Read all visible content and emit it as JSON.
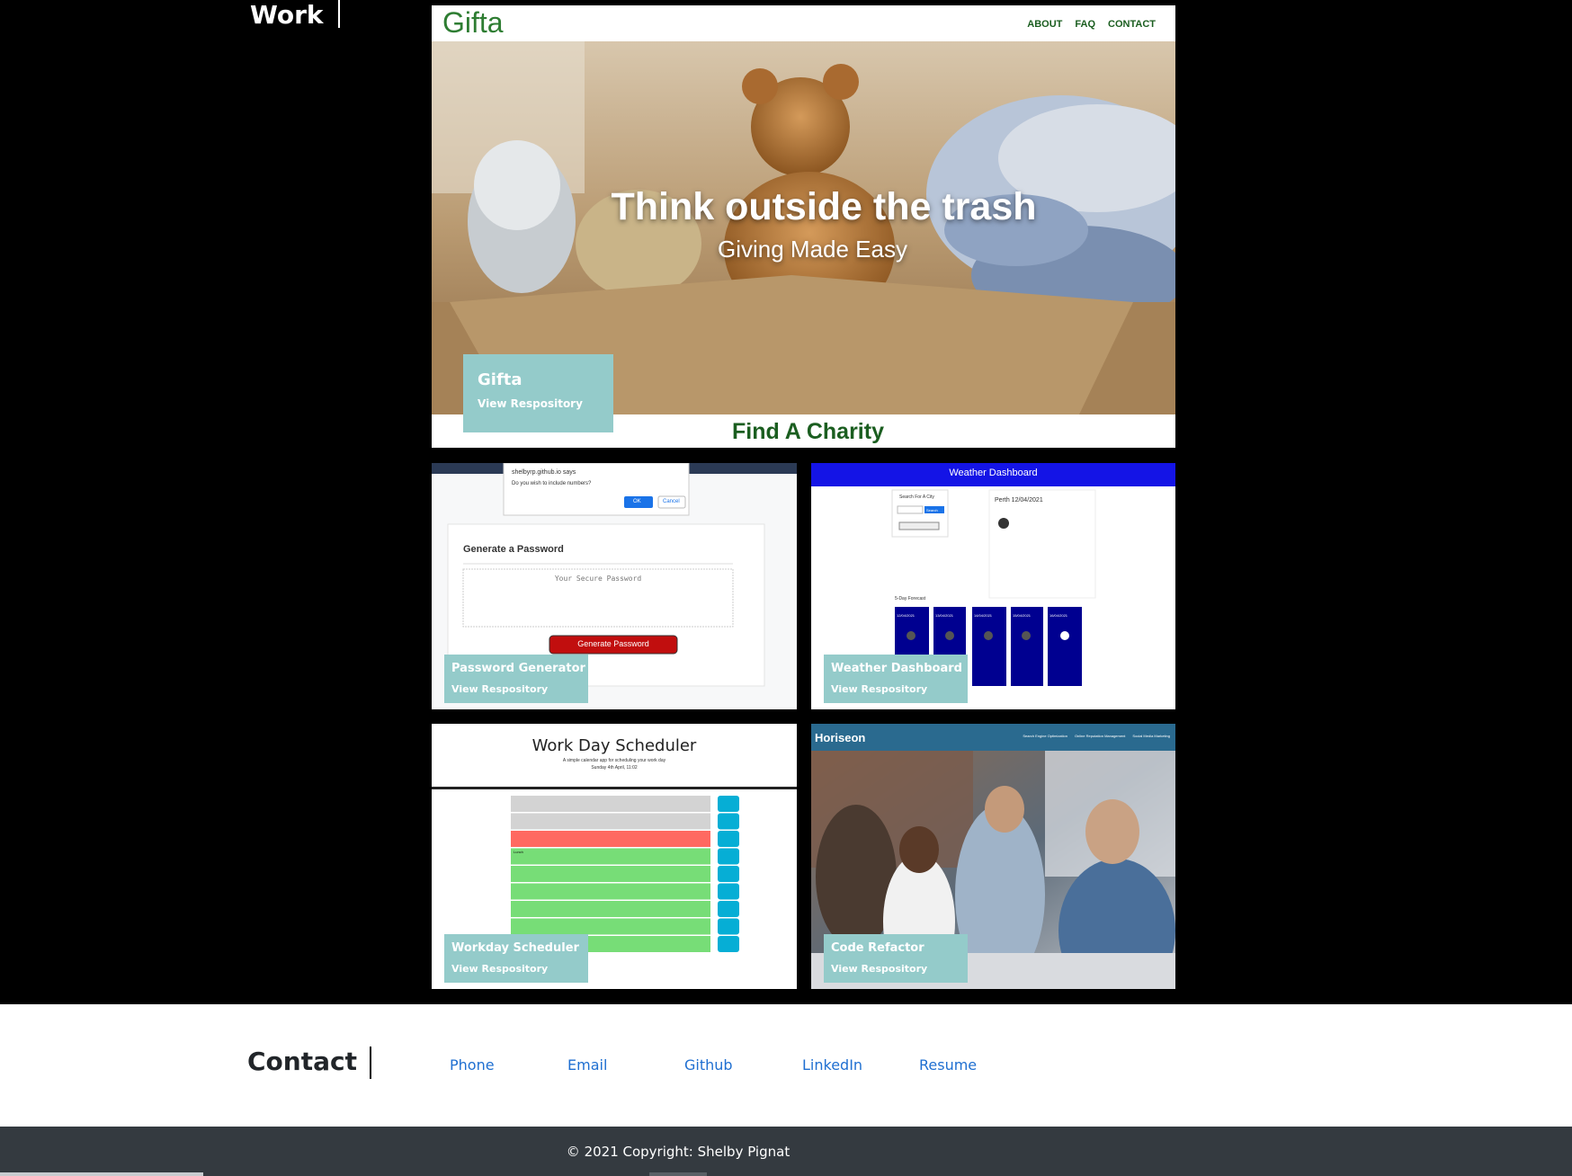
{
  "work": {
    "heading": "Work"
  },
  "projects": {
    "gifta": {
      "title": "Gifta",
      "link": "View Respository",
      "screenshot": {
        "logo": "Gifta",
        "nav": [
          "ABOUT",
          "FAQ",
          "CONTACT"
        ],
        "hero_title": "Think outside the trash",
        "hero_subtitle": "Giving Made Easy",
        "section_title": "Find A Charity"
      }
    },
    "password": {
      "title": "Password Generator",
      "link": "View Respository",
      "screenshot": {
        "dialog_origin": "shelbyrp.github.io says",
        "dialog_question": "Do you wish to include numbers?",
        "dialog_ok": "OK",
        "dialog_cancel": "Cancel",
        "card_title": "Generate a Password",
        "placeholder": "Your Secure Password",
        "button": "Generate Password"
      }
    },
    "weather": {
      "title": "Weather Dashboard",
      "link": "View Respository",
      "screenshot": {
        "header": "Weather Dashboard",
        "search_label": "Search For A City",
        "search_button": "Search",
        "city": "Perth 12/04/2021",
        "forecast_label": "5-Day Forecast",
        "forecast_dates": [
          "12/04/2021",
          "13/04/2021",
          "14/04/2021",
          "15/04/2021",
          "16/04/2021"
        ]
      }
    },
    "scheduler": {
      "title": "Workday Scheduler",
      "link": "View Respository",
      "screenshot": {
        "title": "Work Day Scheduler",
        "subtitle": "A simple calendar app for scheduling your work day",
        "date": "Sunday 4th April, 11:02",
        "first_entry": "Lunch"
      }
    },
    "refactor": {
      "title": "Code Refactor",
      "link": "View Respository",
      "screenshot": {
        "logo": "Horiseon",
        "nav": [
          "Search Engine Optimization",
          "Online Reputation Management",
          "Social Media Marketing"
        ]
      }
    }
  },
  "contact": {
    "heading": "Contact",
    "links": [
      "Phone",
      "Email",
      "Github",
      "LinkedIn",
      "Resume"
    ]
  },
  "footer": {
    "copyright": "© 2021 Copyright: Shelby Pignat"
  },
  "colors": {
    "overlay": "#94cbca",
    "link_blue": "#1f6fd1",
    "footer_bg": "#343a40",
    "gifta_green": "#1b5e20"
  }
}
